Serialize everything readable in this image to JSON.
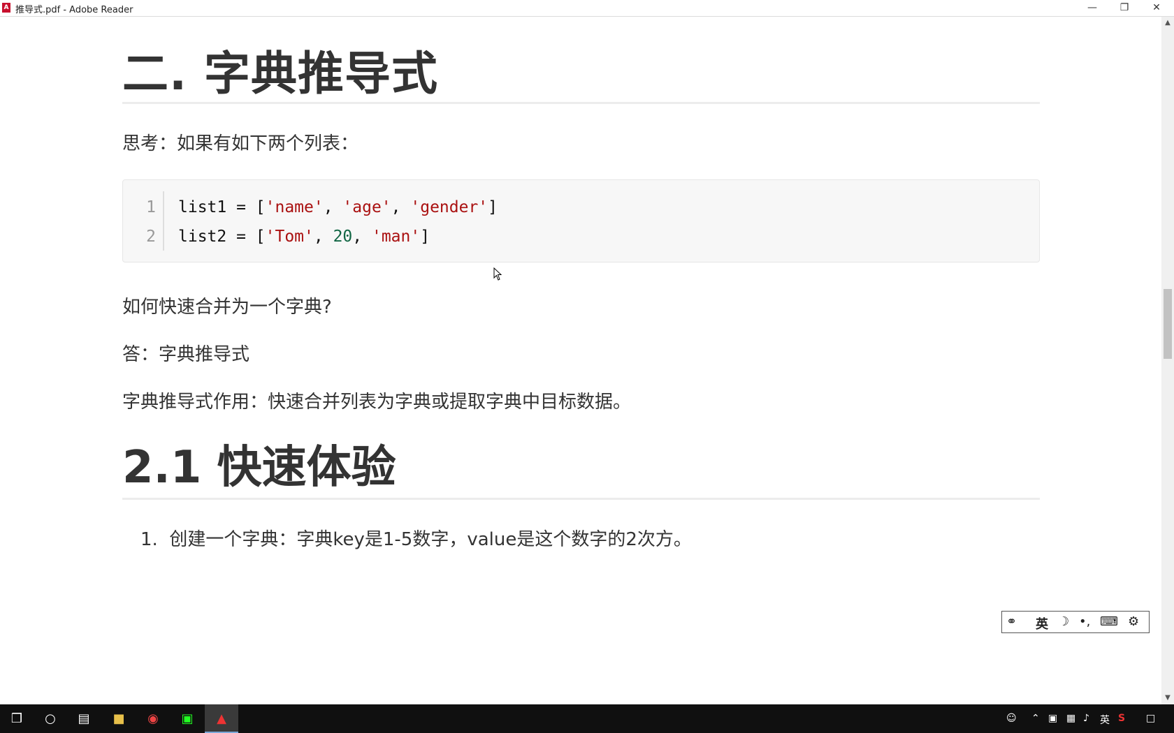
{
  "window": {
    "title": "推导式.pdf - Adobe Reader",
    "app_icon": "pdf-icon",
    "buttons": [
      "minimize-icon",
      "restore-icon",
      "close-icon"
    ]
  },
  "document": {
    "heading1": "二. 字典推导式",
    "think": "思考：如果有如下两个列表：",
    "code": {
      "line_numbers": [
        "1",
        "2"
      ],
      "line1": {
        "a": "list1 = [",
        "s1": "'name'",
        "c1": ", ",
        "s2": "'age'",
        "c2": ", ",
        "s3": "'gender'",
        "end": "]"
      },
      "line2": {
        "a": "list2 = [",
        "s1": "'Tom'",
        "c1": ", ",
        "n1": "20",
        "c2": ", ",
        "s2": "'man'",
        "end": "]"
      }
    },
    "question": "如何快速合并为一个字典?",
    "answer": "答：字典推导式",
    "purpose": "字典推导式作用：快速合并列表为字典或提取字典中目标数据。",
    "heading2": "2.1 快速体验",
    "list_item_number": "1.",
    "list_item": "创建一个字典：字典key是1-5数字，value是这个数字的2次方。"
  },
  "ime_toolbar": {
    "lang": "英",
    "icons": [
      "ime-logo-icon",
      "moon-icon",
      "punctuation-icon",
      "keyboard-icon",
      "gear-icon"
    ]
  },
  "taskbar": {
    "items": [
      "windows-start-icon",
      "search-circle-icon",
      "task-view-icon",
      "file-explorer-icon",
      "chrome-icon",
      "pycharm-icon",
      "adobe-reader-icon"
    ],
    "tray_lang": "英"
  }
}
